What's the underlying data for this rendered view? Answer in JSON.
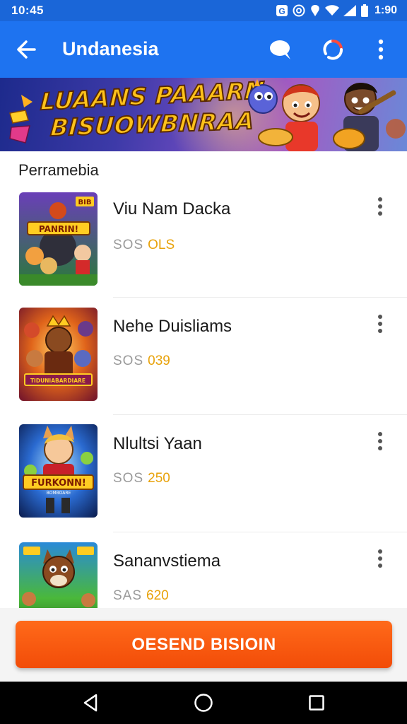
{
  "status_bar": {
    "time": "10:45",
    "clock": "1:90"
  },
  "app_bar": {
    "title": "Undanesia"
  },
  "banner": {
    "line1": "LUAANS PAAARN",
    "line2": "BISUOWBNRAA"
  },
  "section": {
    "heading": "Perramebia"
  },
  "games": [
    {
      "title": "Viu Nam Dacka",
      "meta_label": "SOS",
      "meta_value": "OLS",
      "thumb_badge": "BIB",
      "thumb_banner": "PANRIN!"
    },
    {
      "title": "Nehe Duisliams",
      "meta_label": "SOS",
      "meta_value": "039",
      "thumb_banner": "TIDUNIABARDIARE"
    },
    {
      "title": "Nlultsi Yaan",
      "meta_label": "SOS",
      "meta_value": "250",
      "thumb_banner": "FURKONN!",
      "thumb_sub": "BOMBOARE"
    },
    {
      "title": "Sananvstiema",
      "meta_label": "SAS",
      "meta_value": "620"
    }
  ],
  "cta": {
    "label": "OESEND BISIOIN"
  },
  "colors": {
    "status_bar": "#1a66d8",
    "app_bar": "#1e73f0",
    "accent_orange": "#f24c08",
    "meta_value": "#e8a20a"
  },
  "icons": {
    "back": "arrow-left-icon",
    "search": "search-icon",
    "sync": "sync-icon",
    "more": "more-vert-icon",
    "nav_back": "triangle-back-icon",
    "nav_home": "circle-home-icon",
    "nav_recents": "square-recents-icon"
  }
}
